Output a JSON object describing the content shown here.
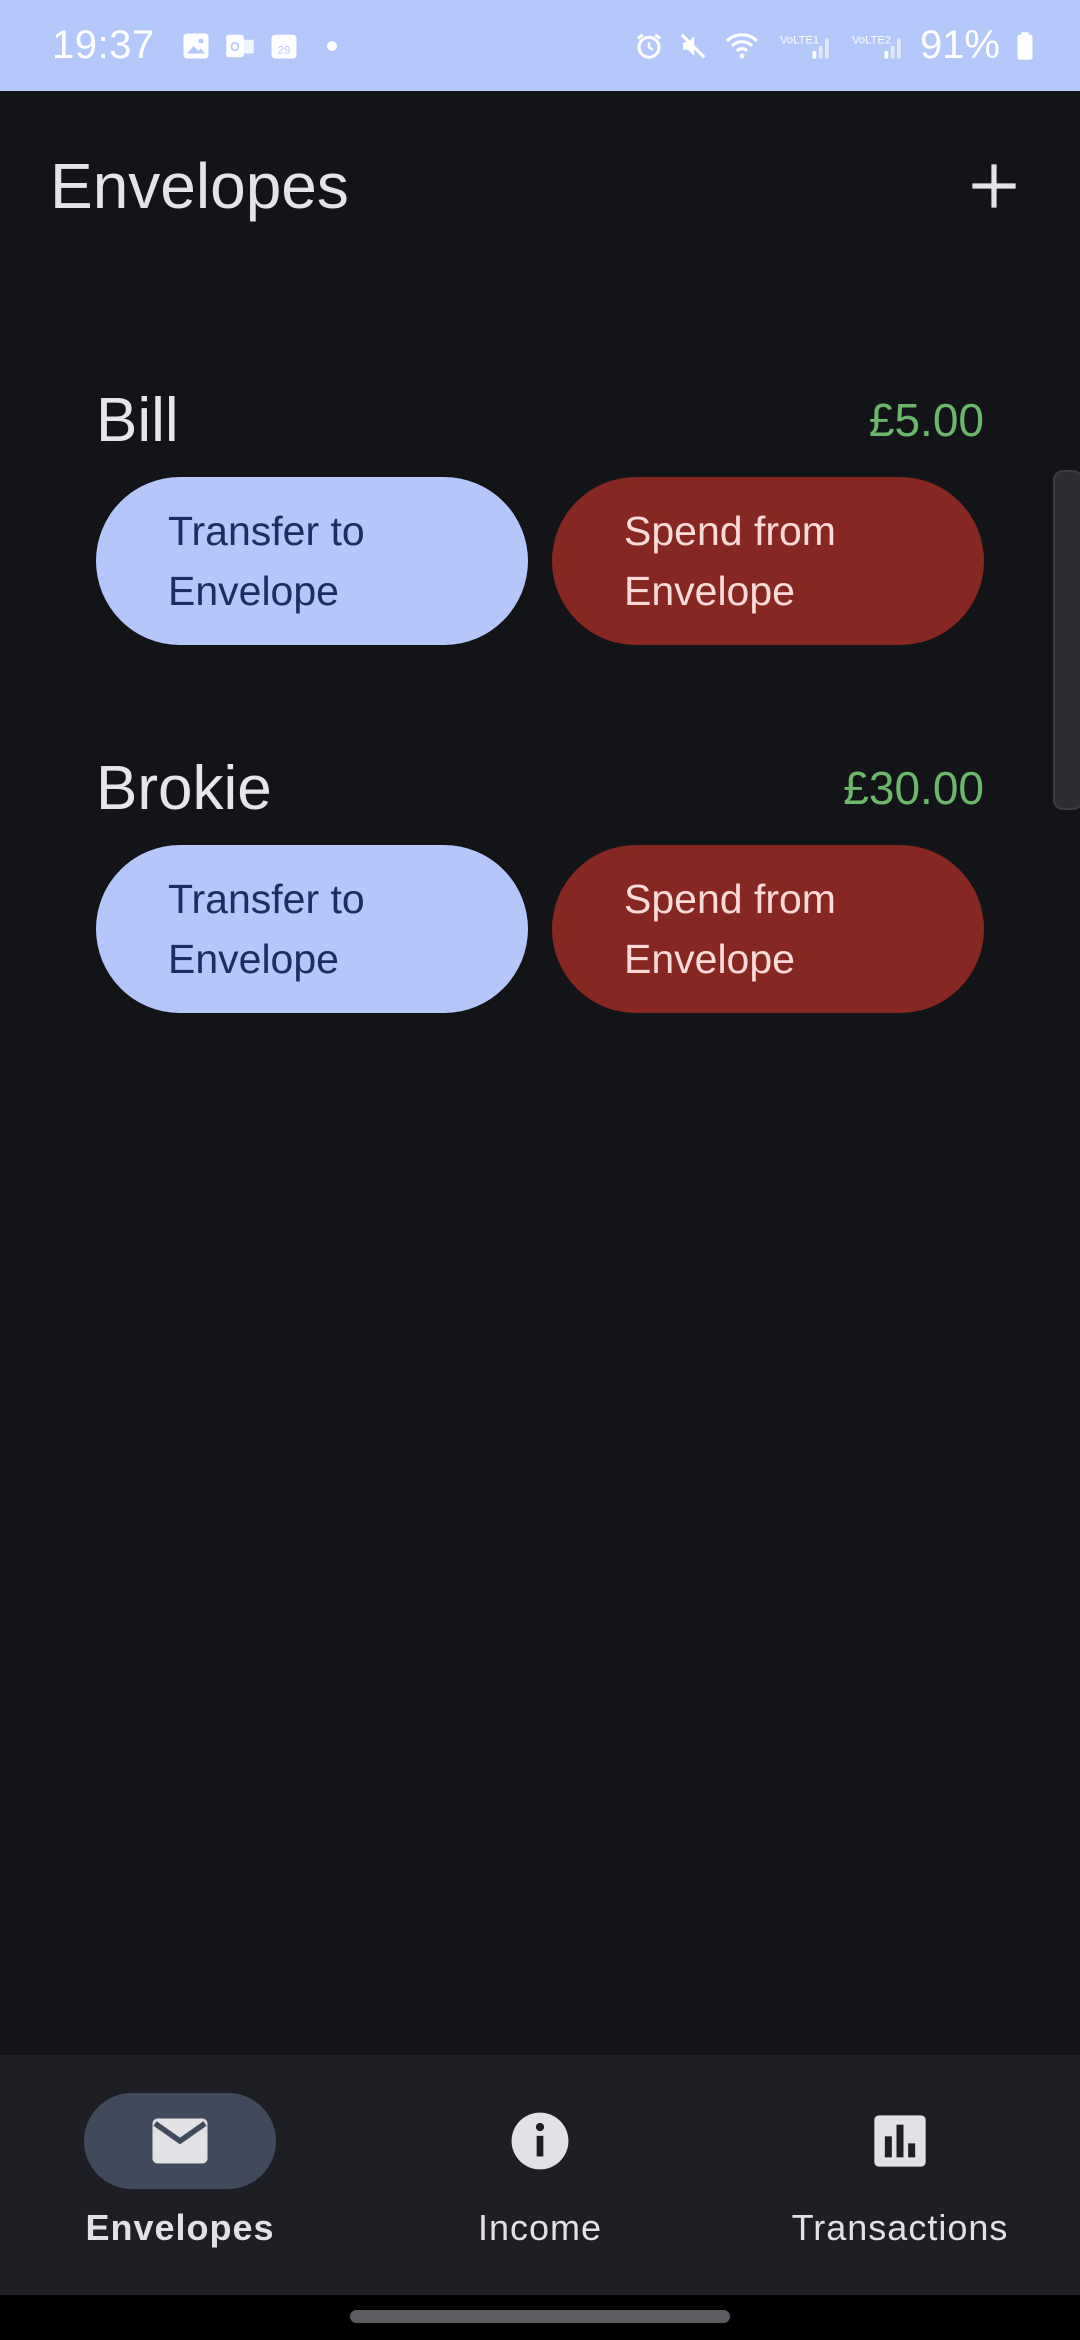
{
  "status_bar": {
    "time": "19:37",
    "battery_percent": "91%",
    "calendar_day": "29",
    "outlook_label": "O",
    "sim1_label": "VoLTE1",
    "sim2_label": "VoLTE2",
    "background_color": "#b5c8fb",
    "icons": [
      "gallery-icon",
      "outlook-icon",
      "calendar-icon",
      "dot-icon",
      "alarm-icon",
      "mute-icon",
      "wifi-icon",
      "signal-lte1-icon",
      "signal-lte2-icon",
      "battery-icon"
    ]
  },
  "app_bar": {
    "title": "Envelopes",
    "add_icon": "plus-icon"
  },
  "envelopes": [
    {
      "name": "Bill",
      "amount": "£5.00",
      "transfer_label": "Transfer to Envelope",
      "spend_label": "Spend from Envelope"
    },
    {
      "name": "Brokie",
      "amount": "£30.00",
      "transfer_label": "Transfer to Envelope",
      "spend_label": "Spend from Envelope"
    }
  ],
  "colors": {
    "background": "#131417",
    "amount_positive": "#6bb86a",
    "transfer_button": "#b5c7fa",
    "spend_button": "#862721",
    "nav_active": "#41495c"
  },
  "bottom_nav": {
    "items": [
      {
        "label": "Envelopes",
        "icon": "mail-icon",
        "active": true
      },
      {
        "label": "Income",
        "icon": "info-icon",
        "active": false
      },
      {
        "label": "Transactions",
        "icon": "bar-chart-icon",
        "active": false
      }
    ]
  }
}
